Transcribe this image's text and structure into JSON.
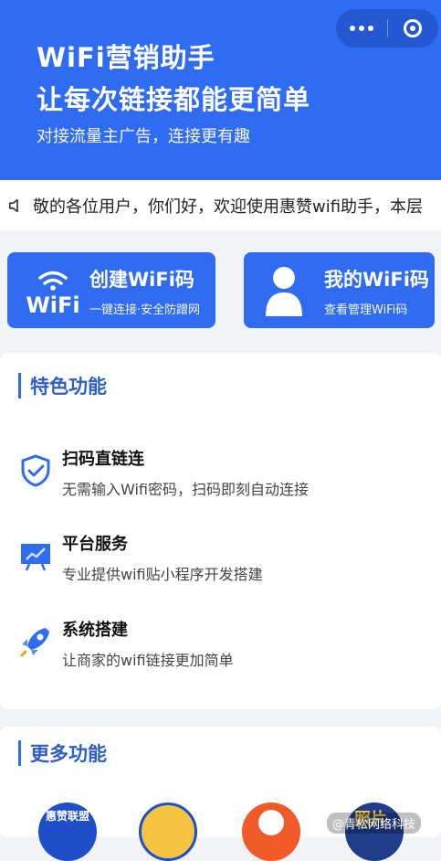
{
  "hero": {
    "title_line1": "WiFi营销助手",
    "title_line2": "让每次链接都能更简单",
    "subtitle": "对接流量主广告，连接更有趣"
  },
  "capsule": {
    "menu_icon": "more-dots-icon",
    "close_icon": "target-icon"
  },
  "notice": {
    "text": "敬的各位用户，你们好，欢迎使用惠赞wifi助手，本层",
    "icon": "speaker-icon"
  },
  "actions": [
    {
      "title": "创建WiFi码",
      "desc": "一键连接·安全防蹭网",
      "icon": "wifi-logo-icon",
      "logo_text": "WiFi"
    },
    {
      "title": "我的WiFi码",
      "desc": "查看管理WiFi码",
      "icon": "user-icon"
    }
  ],
  "features": {
    "title": "特色功能",
    "items": [
      {
        "name": "扫码直链连",
        "desc": "无需输入Wifi密码，扫码即刻自动连接",
        "icon": "shield-check-icon"
      },
      {
        "name": "平台服务",
        "desc": "专业提供wifi贴小程序开发搭建",
        "icon": "presentation-chart-icon"
      },
      {
        "name": "系统搭建",
        "desc": "让商家的wifi链接更加简单",
        "icon": "rocket-icon"
      }
    ]
  },
  "more": {
    "title": "更多功能",
    "items": [
      {
        "label": "惠赞联盟",
        "icon": "huizan-union-icon"
      },
      {
        "label": "",
        "icon": "cartoon-avatar-icon"
      },
      {
        "label": "",
        "icon": "film-reel-icon"
      },
      {
        "label": "照片",
        "icon": "photo-badge-icon"
      }
    ]
  },
  "watermark": "@青松网络科技",
  "colors": {
    "primary": "#2f6cf1",
    "title_blue": "#2f5fc4"
  }
}
